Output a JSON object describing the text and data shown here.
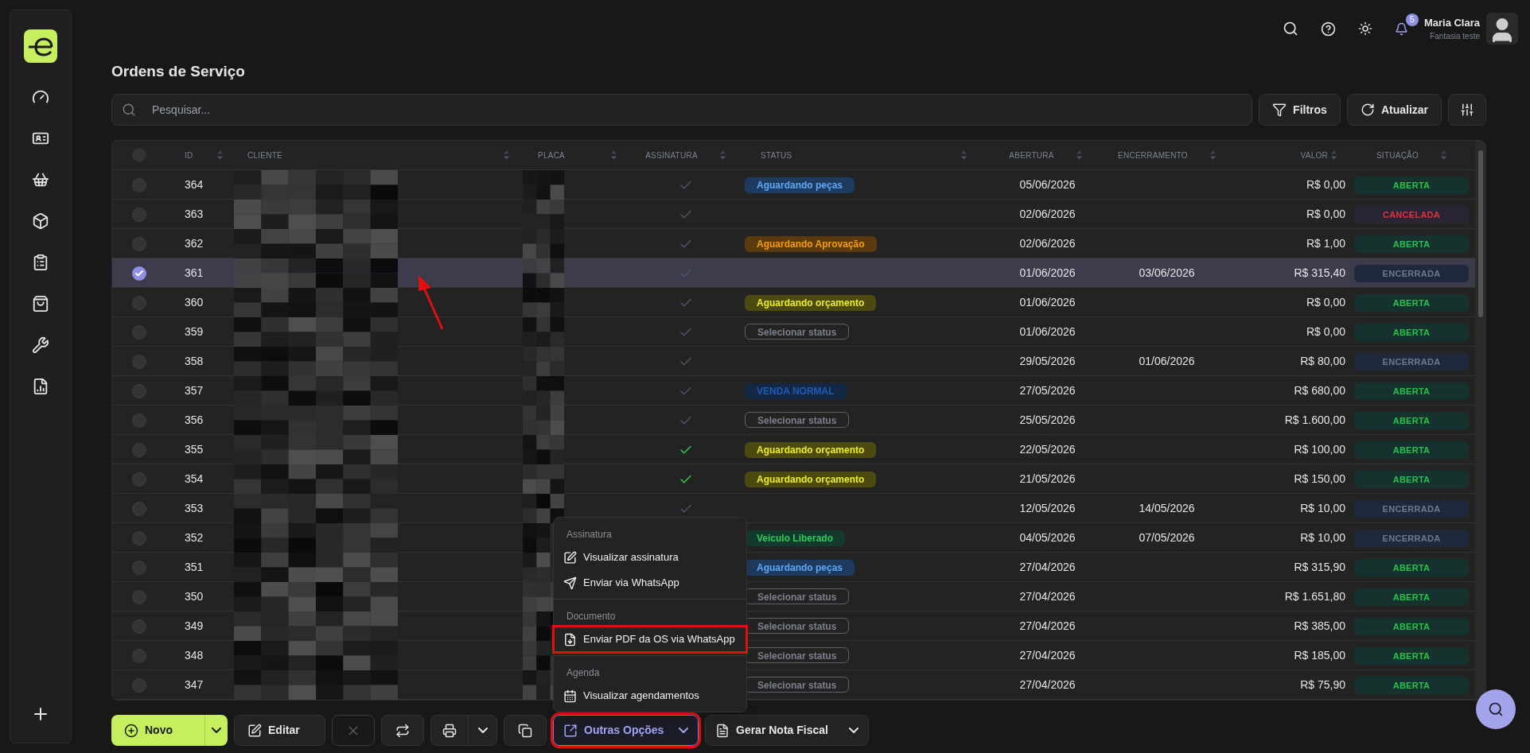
{
  "header": {
    "user_name": "Maria Clara",
    "user_subtitle": "Fantasia teste",
    "notification_count": "5"
  },
  "page_title": "Ordens de Serviço",
  "search": {
    "placeholder": "Pesquisar..."
  },
  "toolbar_buttons": [
    {
      "label": "Filtros",
      "kind": "filter"
    },
    {
      "label": "Atualizar",
      "kind": "refresh"
    },
    {
      "kind": "columns"
    }
  ],
  "table": {
    "header_checkbox": {
      "checked": false
    },
    "columns": [
      {
        "label": "ID"
      },
      {
        "label": "CLIENTE"
      },
      {
        "label": "PLACA"
      },
      {
        "label": "ASSINATURA"
      },
      {
        "label": "STATUS"
      },
      {
        "label": "ABERTURA"
      },
      {
        "label": "ENCERRAMENTO"
      },
      {
        "label": "VALOR"
      },
      {
        "label": "SITUAÇÃO"
      }
    ],
    "rows": [
      {
        "id": "364",
        "selected": false,
        "signed": false,
        "status": {
          "label": "Aguardando peças",
          "kind": "blue"
        },
        "opened": "05/06/2026",
        "value": "R$ 0,00",
        "situation": {
          "label": "ABERTA",
          "kind": "open"
        }
      },
      {
        "id": "363",
        "selected": false,
        "signed": false,
        "opened": "02/06/2026",
        "value": "R$ 0,00",
        "situation": {
          "label": "CANCELADA",
          "kind": "cancelled"
        }
      },
      {
        "id": "362",
        "selected": false,
        "signed": false,
        "status": {
          "label": "Aguardando Aprovação",
          "kind": "orange"
        },
        "opened": "02/06/2026",
        "value": "R$ 1,00",
        "situation": {
          "label": "ABERTA",
          "kind": "open"
        }
      },
      {
        "id": "361",
        "selected": true,
        "signed": false,
        "opened": "01/06/2026",
        "closed": "03/06/2026",
        "value": "R$ 315,40",
        "situation": {
          "label": "ENCERRADA",
          "kind": "closed"
        }
      },
      {
        "id": "360",
        "selected": false,
        "signed": false,
        "status": {
          "label": "Aguardando orçamento",
          "kind": "yellow"
        },
        "opened": "01/06/2026",
        "value": "R$ 0,00",
        "situation": {
          "label": "ABERTA",
          "kind": "open"
        }
      },
      {
        "id": "359",
        "selected": false,
        "signed": false,
        "status": {
          "label": "Selecionar status",
          "kind": "empty"
        },
        "opened": "01/06/2026",
        "value": "R$ 0,00",
        "situation": {
          "label": "ABERTA",
          "kind": "open"
        }
      },
      {
        "id": "358",
        "selected": false,
        "signed": false,
        "opened": "29/05/2026",
        "closed": "01/06/2026",
        "value": "R$ 80,00",
        "situation": {
          "label": "ENCERRADA",
          "kind": "closed"
        }
      },
      {
        "id": "357",
        "selected": false,
        "signed": false,
        "status": {
          "label": "VENDA NORMAL",
          "kind": "navy"
        },
        "opened": "27/05/2026",
        "value": "R$ 680,00",
        "situation": {
          "label": "ABERTA",
          "kind": "open"
        }
      },
      {
        "id": "356",
        "selected": false,
        "signed": false,
        "status": {
          "label": "Selecionar status",
          "kind": "empty"
        },
        "opened": "25/05/2026",
        "value": "R$ 1.600,00",
        "situation": {
          "label": "ABERTA",
          "kind": "open"
        }
      },
      {
        "id": "355",
        "selected": false,
        "signed": true,
        "status": {
          "label": "Aguardando orçamento",
          "kind": "yellow"
        },
        "opened": "22/05/2026",
        "value": "R$ 100,00",
        "situation": {
          "label": "ABERTA",
          "kind": "open"
        }
      },
      {
        "id": "354",
        "selected": false,
        "signed": true,
        "status": {
          "label": "Aguardando orçamento",
          "kind": "yellow"
        },
        "opened": "21/05/2026",
        "value": "R$ 150,00",
        "situation": {
          "label": "ABERTA",
          "kind": "open"
        }
      },
      {
        "id": "353",
        "selected": false,
        "signed": false,
        "opened": "12/05/2026",
        "closed": "14/05/2026",
        "value": "R$ 10,00",
        "situation": {
          "label": "ENCERRADA",
          "kind": "closed"
        }
      },
      {
        "id": "352",
        "selected": false,
        "status": {
          "label": "Veiculo Liberado",
          "kind": "green"
        },
        "opened": "04/05/2026",
        "closed": "07/05/2026",
        "value": "R$ 10,00",
        "situation": {
          "label": "ENCERRADA",
          "kind": "closed"
        }
      },
      {
        "id": "351",
        "selected": false,
        "status": {
          "label": "Aguardando peças",
          "kind": "blue"
        },
        "opened": "27/04/2026",
        "value": "R$ 315,90",
        "situation": {
          "label": "ABERTA",
          "kind": "open"
        }
      },
      {
        "id": "350",
        "selected": false,
        "status": {
          "label": "Selecionar status",
          "kind": "empty"
        },
        "opened": "27/04/2026",
        "value": "R$ 1.651,80",
        "situation": {
          "label": "ABERTA",
          "kind": "open"
        }
      },
      {
        "id": "349",
        "selected": false,
        "status": {
          "label": "Selecionar status",
          "kind": "empty"
        },
        "opened": "27/04/2026",
        "value": "R$ 385,00",
        "situation": {
          "label": "ABERTA",
          "kind": "open"
        }
      },
      {
        "id": "348",
        "selected": false,
        "status": {
          "label": "Selecionar status",
          "kind": "empty"
        },
        "opened": "27/04/2026",
        "value": "R$ 185,00",
        "situation": {
          "label": "ABERTA",
          "kind": "open"
        }
      },
      {
        "id": "347",
        "selected": false,
        "status": {
          "label": "Selecionar status",
          "kind": "empty"
        },
        "opened": "27/04/2026",
        "value": "R$ 75,90",
        "situation": {
          "label": "ABERTA",
          "kind": "open"
        }
      }
    ]
  },
  "menu": {
    "sections": [
      {
        "title": "Assinatura",
        "items": [
          {
            "label": "Visualizar assinatura",
            "kind": "edit",
            "highlighted": false
          },
          {
            "label": "Enviar via WhatsApp",
            "kind": "send",
            "highlighted": false
          }
        ]
      },
      {
        "title": "Documento",
        "items": [
          {
            "label": "Enviar PDF da OS via WhatsApp",
            "kind": "pdf",
            "highlighted": true
          }
        ]
      },
      {
        "title": "Agenda",
        "items": [
          {
            "label": "Visualizar agendamentos",
            "kind": "calendar",
            "highlighted": false
          }
        ]
      }
    ]
  },
  "actions": [
    {
      "label": "Novo",
      "kind": "new",
      "disabled": false,
      "active": false,
      "highlighted": false
    },
    {
      "label": "Editar",
      "kind": "edit",
      "disabled": false,
      "active": false,
      "highlighted": false
    },
    {
      "kind": "cancel",
      "disabled": true,
      "active": false,
      "highlighted": false
    },
    {
      "kind": "swap",
      "disabled": false,
      "active": false,
      "highlighted": false
    },
    {
      "kind": "print",
      "disabled": false,
      "active": false,
      "highlighted": false
    },
    {
      "kind": "copy",
      "disabled": false,
      "active": false,
      "highlighted": false
    },
    {
      "label": "Outras Opções",
      "kind": "more",
      "disabled": false,
      "active": true,
      "highlighted": true
    },
    {
      "label": "Gerar Nota Fiscal",
      "kind": "invoice",
      "disabled": false,
      "active": false,
      "highlighted": false
    }
  ]
}
